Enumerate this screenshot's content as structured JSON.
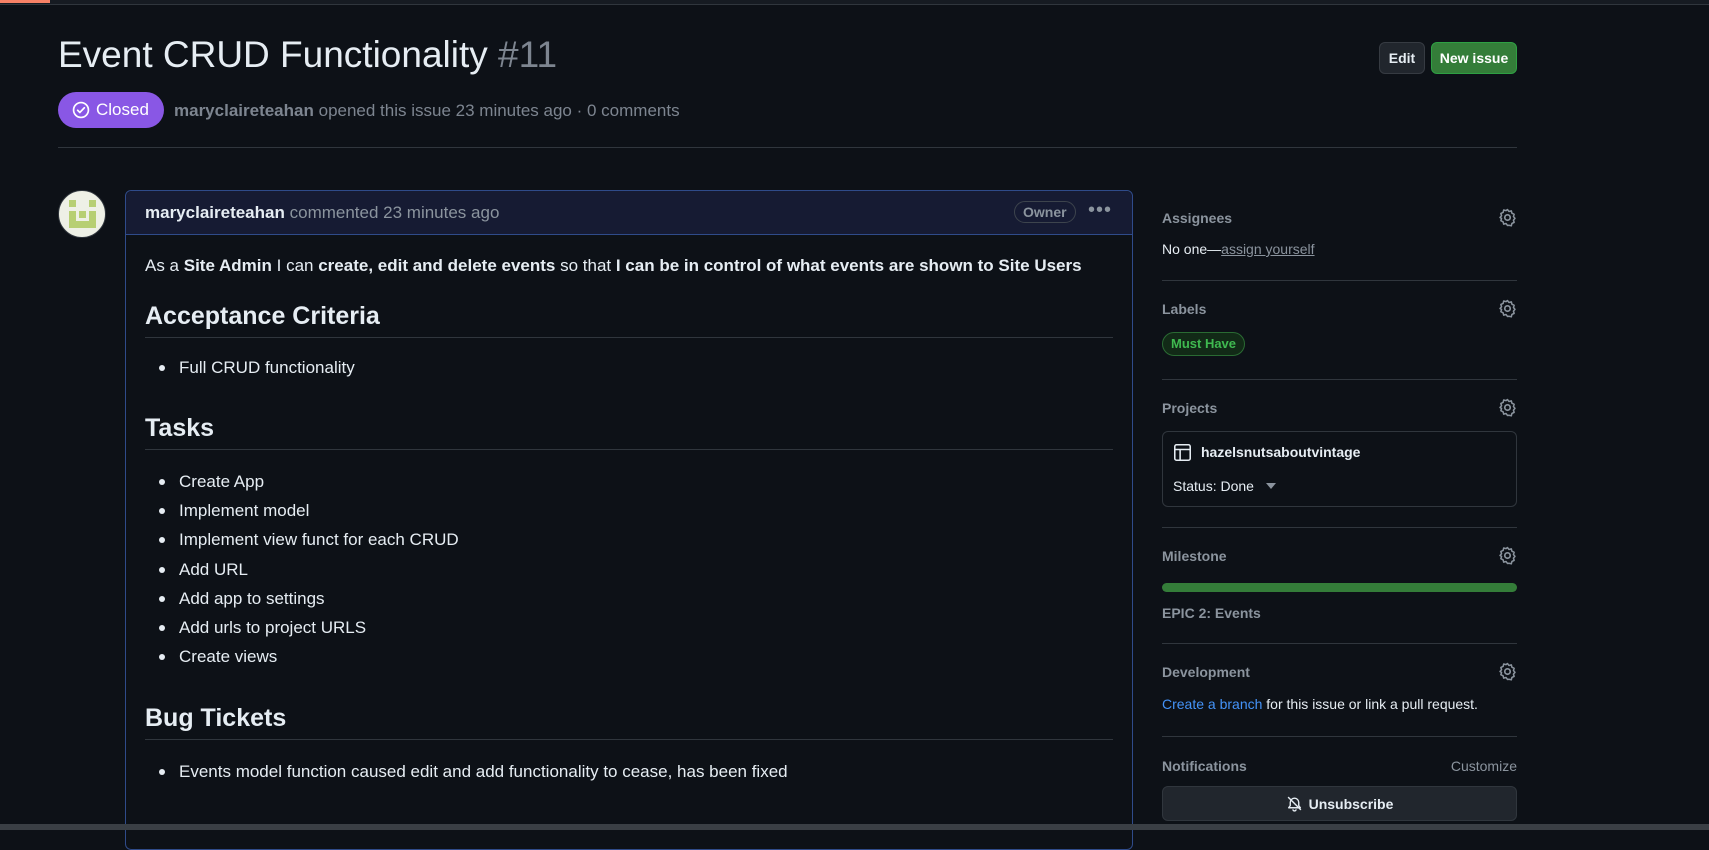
{
  "issue": {
    "title": "Event CRUD Functionality",
    "number": "#11",
    "state": "Closed",
    "author": "maryclaireteahan",
    "opened_text": "opened this issue 23 minutes ago · 0 comments"
  },
  "actions": {
    "edit_label": "Edit",
    "new_issue_label": "New issue"
  },
  "comment": {
    "author": "maryclaireteahan",
    "time": "commented 23 minutes ago",
    "role_badge": "Owner",
    "intro": {
      "t1": "As a ",
      "b1": "Site Admin",
      "t2": " I can ",
      "b2": "create, edit and delete events",
      "t3": " so that ",
      "b3": "I can be in control of what events are shown to Site Users"
    },
    "sections": [
      {
        "heading": "Acceptance Criteria",
        "items": [
          "Full CRUD functionality"
        ]
      },
      {
        "heading": "Tasks",
        "items": [
          "Create App",
          "Implement model",
          "Implement view funct for each CRUD",
          "Add URL",
          "Add app to settings",
          "Add urls to project URLS",
          "Create views"
        ]
      },
      {
        "heading": "Bug Tickets",
        "items": [
          "Events model function caused edit and add functionality to cease, has been fixed"
        ]
      }
    ]
  },
  "sidebar": {
    "assignees": {
      "heading": "Assignees",
      "value": "No one—",
      "link": "assign yourself"
    },
    "labels": {
      "heading": "Labels",
      "items": [
        "Must Have"
      ],
      "color": "#3fb950"
    },
    "projects": {
      "heading": "Projects",
      "name": "hazelsnutsaboutvintage",
      "status": "Status: Done"
    },
    "milestone": {
      "heading": "Milestone",
      "name": "EPIC 2: Events",
      "progress_percent": 100
    },
    "development": {
      "heading": "Development",
      "link": "Create a branch",
      "text": " for this issue or link a pull request."
    },
    "notifications": {
      "heading": "Notifications",
      "customize": "Customize",
      "button": "Unsubscribe"
    }
  },
  "icons": [
    "check-circle-icon",
    "kebab-icon",
    "gear-icon",
    "table-icon",
    "caret-down-icon",
    "bell-slash-icon"
  ],
  "colors": {
    "closed": "#8957e5",
    "new_issue": "#347d39",
    "link": "#4493f8",
    "bg": "#0d1117"
  }
}
